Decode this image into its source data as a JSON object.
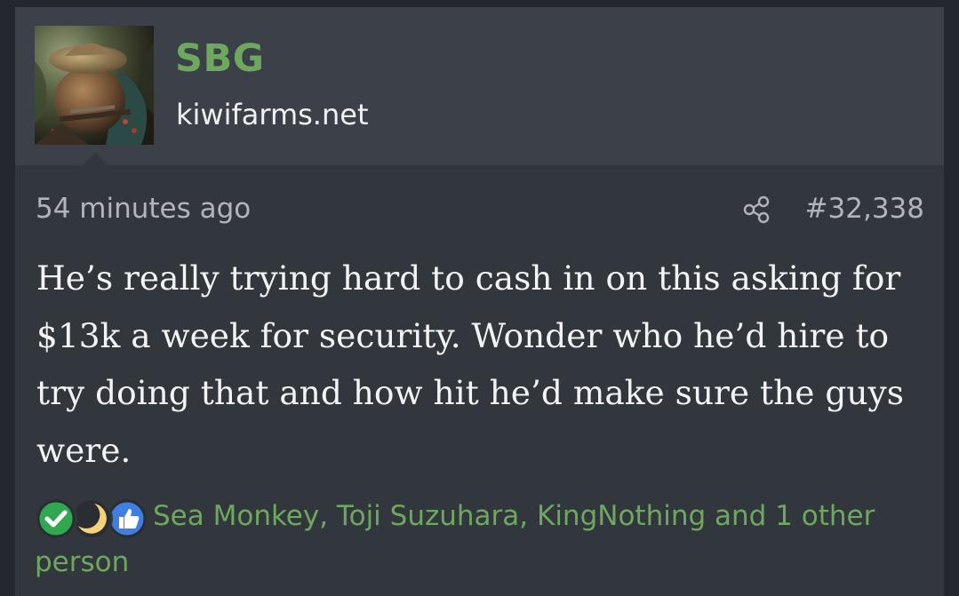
{
  "post": {
    "author": {
      "name": "SBG",
      "title": "kiwifarms.net"
    },
    "timestamp": "54 minutes ago",
    "post_number": "#32,338",
    "body": "He’s really trying hard to cash in on this asking for $13k a week for security. Wonder who he’d hire to try doing that and how hit he’d make sure the guys were.",
    "reactions": {
      "icons": [
        "check-icon",
        "moon-icon",
        "thumbs-up-icon"
      ],
      "text": "Sea Monkey, Toji Suzuhara, KingNothing and 1 other person"
    }
  },
  "colors": {
    "page_bg": "#24272d",
    "post_bg": "#32363d",
    "header_bg": "#3c4048",
    "username": "#6ea85e",
    "meta_text": "#b1b5bb",
    "body_text": "#f4f4f4",
    "reaction_link": "#6ea85e"
  }
}
